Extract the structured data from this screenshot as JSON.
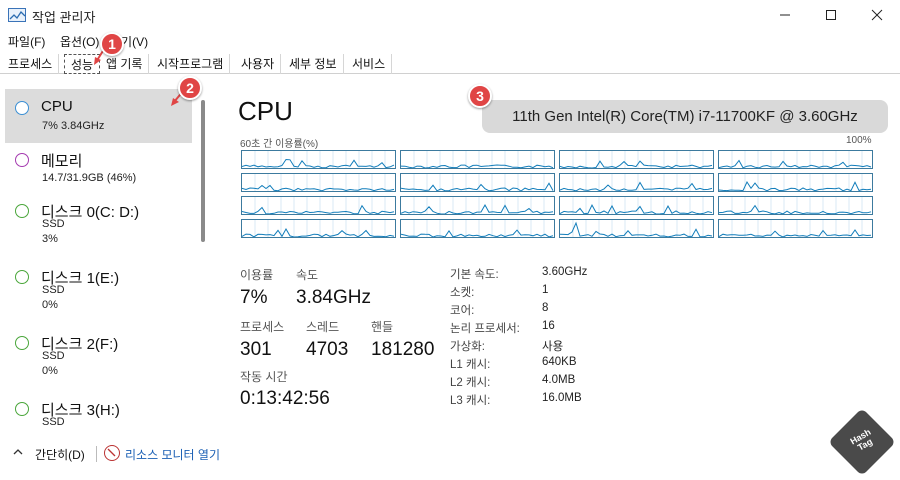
{
  "window": {
    "title": "작업 관리자"
  },
  "menu": [
    "파일(F)",
    "옵션(O)",
    "보기(V)"
  ],
  "tabs": [
    "프로세스",
    "성능",
    "앱 기록",
    "시작프로그램",
    "사용자",
    "세부 정보",
    "서비스"
  ],
  "active_tab": "성능",
  "badges": [
    "1",
    "2",
    "3"
  ],
  "sidebar": [
    {
      "name": "CPU",
      "sub1": "7% 3.84GHz",
      "sub2": "",
      "color": "#3b8fd4"
    },
    {
      "name": "메모리",
      "sub1": "14.7/31.9GB (46%)",
      "sub2": "",
      "color": "#a53bb0"
    },
    {
      "name": "디스크 0(C: D:)",
      "sub1": "SSD",
      "sub2": "3%",
      "color": "#4aa63b"
    },
    {
      "name": "디스크 1(E:)",
      "sub1": "SSD",
      "sub2": "0%",
      "color": "#4aa63b"
    },
    {
      "name": "디스크 2(F:)",
      "sub1": "SSD",
      "sub2": "0%",
      "color": "#4aa63b"
    },
    {
      "name": "디스크 3(H:)",
      "sub1": "SSD",
      "sub2": "",
      "color": "#4aa63b"
    }
  ],
  "main": {
    "title": "CPU",
    "model": "11th Gen Intel(R) Core(TM) i7-11700KF @ 3.60GHz",
    "graph_label": "60초 간 이용률(%)",
    "graph_max": "100%",
    "graph_color": "#117dbb",
    "stats": {
      "util_label": "이용률",
      "util_value": "7%",
      "speed_label": "속도",
      "speed_value": "3.84GHz",
      "proc_label": "프로세스",
      "proc_value": "301",
      "thread_label": "스레드",
      "thread_value": "4703",
      "handle_label": "핸들",
      "handle_value": "181280",
      "uptime_label": "작동 시간",
      "uptime_value": "0:13:42:56"
    },
    "details": [
      {
        "label": "기본 속도:",
        "value": "3.60GHz"
      },
      {
        "label": "소켓:",
        "value": "1"
      },
      {
        "label": "코어:",
        "value": "8"
      },
      {
        "label": "논리 프로세서:",
        "value": "16"
      },
      {
        "label": "가상화:",
        "value": "사용"
      },
      {
        "label": "L1 캐시:",
        "value": "640KB"
      },
      {
        "label": "L2 캐시:",
        "value": "4.0MB"
      },
      {
        "label": "L3 캐시:",
        "value": "16.0MB"
      }
    ]
  },
  "footer": {
    "simple": "간단히(D)",
    "resource_monitor": "리소스 모니터 열기"
  },
  "watermark": "Hash Tag"
}
